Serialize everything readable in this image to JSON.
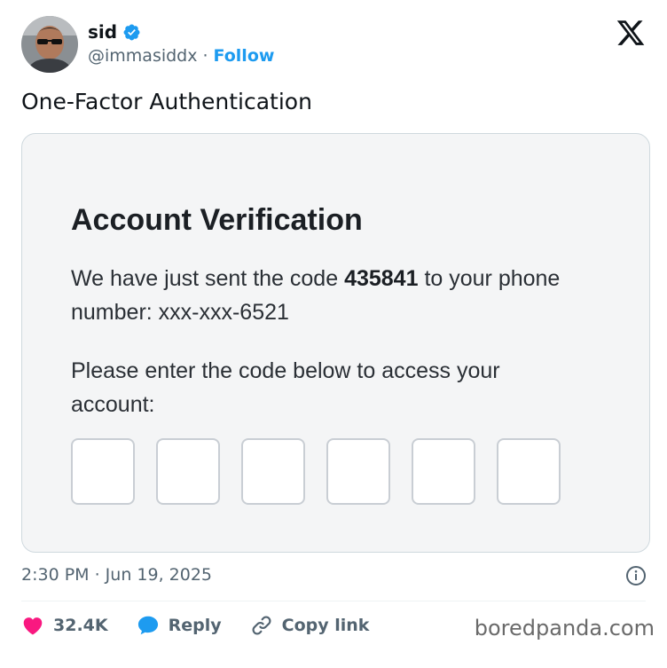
{
  "author": {
    "name": "sid",
    "handle": "@immasiddx",
    "separator": "·",
    "follow_label": "Follow",
    "verified": true
  },
  "tweet": {
    "text": "One-Factor Authentication",
    "timestamp": "2:30 PM · Jun 19, 2025"
  },
  "card": {
    "title": "Account Verification",
    "line1_prefix": "We have just sent the code ",
    "code": "435841",
    "line1_suffix": " to your phone number: xxx-xxx-6521",
    "line2": "Please enter the code below to access your account:",
    "code_box_count": 6
  },
  "actions": {
    "likes": "32.4K",
    "reply_label": "Reply",
    "copy_link_label": "Copy link"
  },
  "watermark": "boredpanda.com",
  "colors": {
    "accent": "#1d9bf0",
    "like": "#f91880",
    "muted": "#536471",
    "text": "#0f1419"
  }
}
